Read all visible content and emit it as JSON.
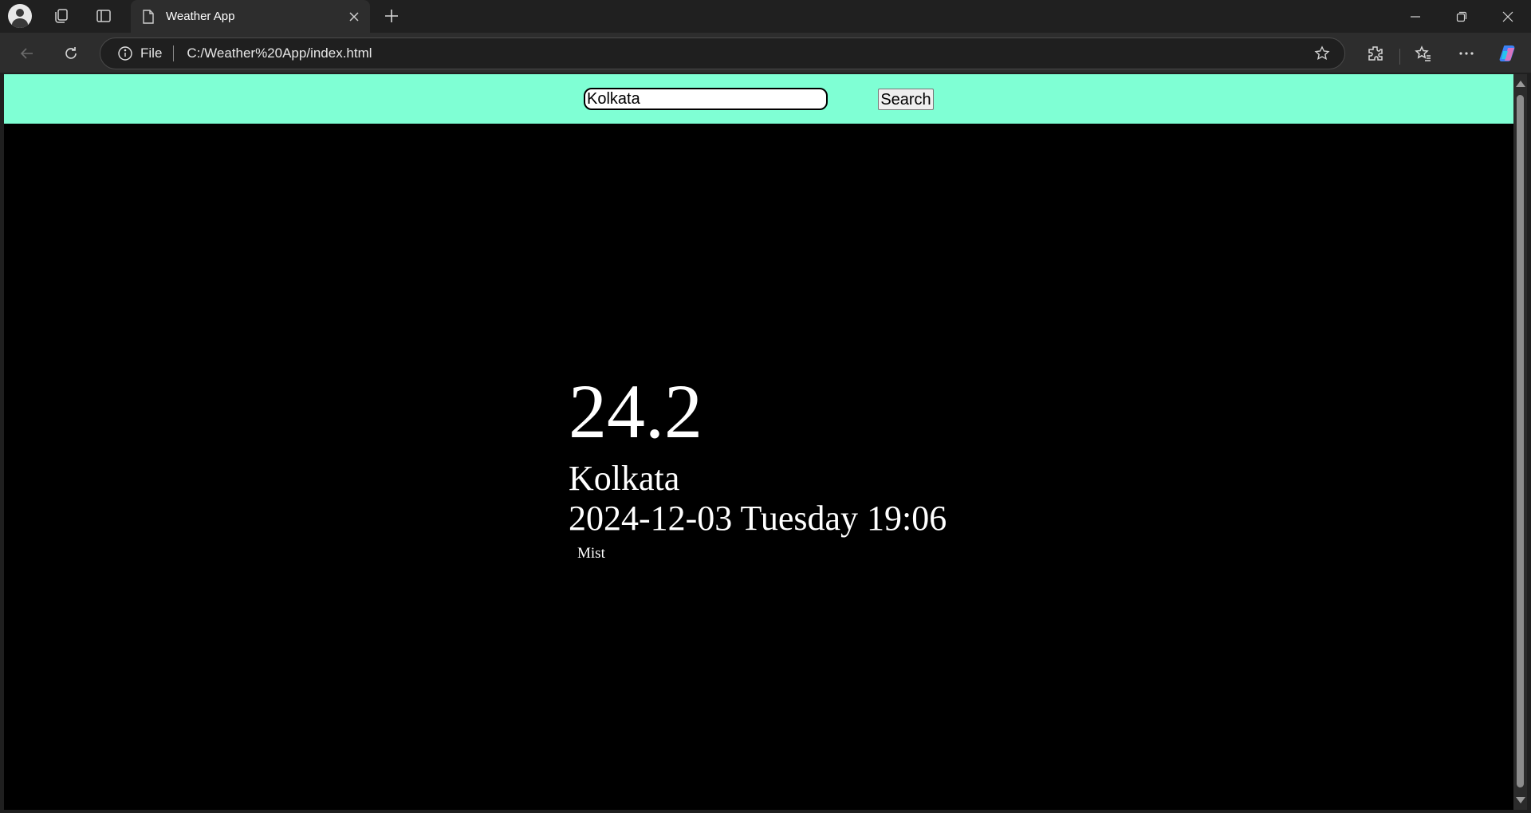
{
  "browser": {
    "tab": {
      "title": "Weather App"
    },
    "address": {
      "scheme": "File",
      "url": "C:/Weather%20App/index.html"
    },
    "icons": [
      "profile-icon",
      "workspaces-icon",
      "tab-actions-icon",
      "page-icon",
      "close-icon",
      "plus-icon",
      "minimize-icon",
      "restore-icon",
      "window-close-icon",
      "back-icon",
      "reload-icon",
      "info-icon",
      "star-icon",
      "extensions-icon",
      "favorites-icon",
      "more-icon",
      "copilot-icon"
    ]
  },
  "page": {
    "colors": {
      "header_bg": "#7fffd4",
      "body_bg": "#000000",
      "text": "#ffffff"
    },
    "search": {
      "value": "Kolkata",
      "button_label": "Search"
    },
    "weather": {
      "temperature": "24.2",
      "city": "Kolkata",
      "datetime": "2024-12-03 Tuesday 19:06",
      "description": "Mist"
    }
  }
}
